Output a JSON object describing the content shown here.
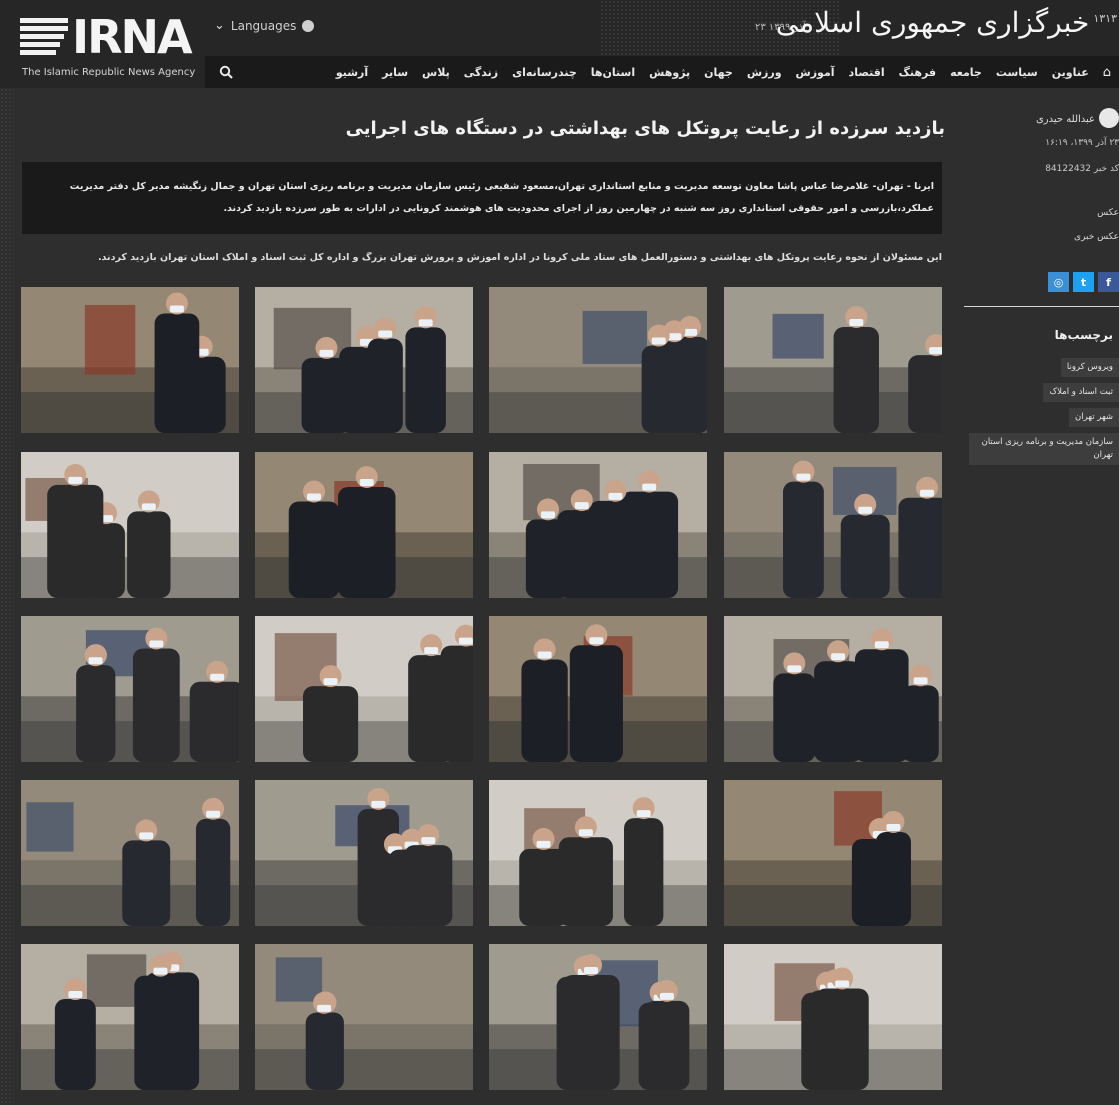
{
  "header": {
    "logo_text": "IRNA",
    "logo_tagline": "The Islamic Republic News Agency",
    "languages_label": "Languages",
    "date": "۲۳ آذر ۱۳۹۹",
    "brand": "خبرگزاری جمهوری اسلامی",
    "brand_year": "۱۳۱۳"
  },
  "nav": {
    "items": [
      "عناوین",
      "سیاست",
      "جامعه",
      "فرهنگ",
      "اقتصاد",
      "آموزش",
      "ورزش",
      "جهان",
      "پژوهش",
      "استان‌ها",
      "چندرسانه‌ای",
      "زندگی",
      "پلاس",
      "سایر",
      "آرشیو"
    ]
  },
  "article": {
    "title": "بازدید سرزده از رعایت پروتکل های بهداشتی در دستگاه های اجرایی",
    "lead": "ایرنا - تهران- غلامرضا عباس پاشا معاون توسعه مدیریت و منابع استانداری تهران،مسعود شفیعی رئیس سازمان مدیریت و برنامه ریزی استان تهران و جمال زنگیشه مدیر کل دفتر مدیریت عملکرد،بازرسی و امور حقوقی استانداری روز سه شنبه در چهارمین روز از اجرای محدودیت های هوشمند کرونایی در ادارات به طور سرزده بازدید کردند.",
    "body": "این مسئولان از نحوه رعایت پروتکل های بهداشتی و دستورالعمل های ستاد ملی کرونا در اداره آموزش و پرورش تهران بزرگ و اداره کل ثبت اسناد و املاک استان تهران بازدید کردند."
  },
  "sidebar": {
    "author": "عبدالله حیدری",
    "pubdate": "۲۳ آذر ۱۳۹۹، ۱۶:۱۹",
    "news_id": "کد خبر 84122432",
    "photo_label": "عکس",
    "photo_news_label": "عکس خبری",
    "share": [
      {
        "label": "f",
        "color": "#3b5998",
        "icon": "facebook-icon"
      },
      {
        "label": "t",
        "color": "#1da1f2",
        "icon": "twitter-icon"
      },
      {
        "label": "◎",
        "color": "#3b8fd6",
        "icon": "telegram-icon"
      }
    ],
    "tags_title": "برچسب‌ها",
    "tags": [
      "ویروس کرونا",
      "ثبت اسناد و املاک",
      "شهر تهران",
      "سازمان مدیریت و برنامه ریزی استان تهران"
    ]
  },
  "gallery": {
    "photos": [
      {
        "desc": "receptionist"
      },
      {
        "desc": "officials-standing"
      },
      {
        "desc": "man-mask"
      },
      {
        "desc": "office-group"
      },
      {
        "desc": "officials-talk"
      },
      {
        "desc": "office-visit"
      },
      {
        "desc": "office-desk"
      },
      {
        "desc": "man-sweater"
      },
      {
        "desc": "hall-group"
      },
      {
        "desc": "desk-office"
      },
      {
        "desc": "corridor-people"
      },
      {
        "desc": "archive-room"
      },
      {
        "desc": "waiting-hall"
      },
      {
        "desc": "meeting-room"
      },
      {
        "desc": "woman-office"
      },
      {
        "desc": "file-room"
      },
      {
        "desc": "crowd-window"
      },
      {
        "desc": "crowd-officials"
      },
      {
        "desc": "counter-people"
      },
      {
        "desc": "men-group"
      }
    ]
  },
  "colors": {
    "bg": "#2e2e2e",
    "header": "#262626",
    "nav": "#1a1a1a",
    "lead_box": "#1a1a1a",
    "tag_bg": "#3d3d3d"
  }
}
